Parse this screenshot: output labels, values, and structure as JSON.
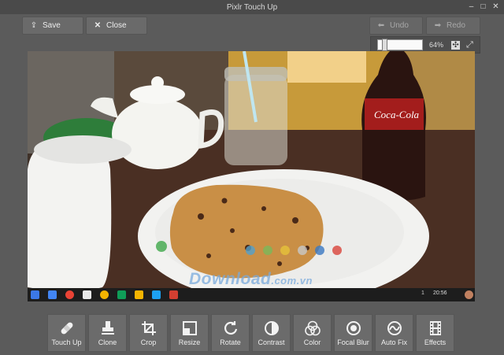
{
  "window": {
    "title": "Pixlr Touch Up"
  },
  "toolbar": {
    "save_label": "Save",
    "close_label": "Close",
    "undo_label": "Undo",
    "redo_label": "Redo"
  },
  "zoom": {
    "level": "64%",
    "slider_value": 0.1
  },
  "canvas": {
    "watermark": "Download",
    "watermark_suffix": ".com.vn",
    "shelf_clock": "20:56",
    "shelf_badge": "1"
  },
  "tools": [
    {
      "label": "Touch Up",
      "icon": "bandage-icon"
    },
    {
      "label": "Clone",
      "icon": "stamp-icon"
    },
    {
      "label": "Crop",
      "icon": "crop-icon"
    },
    {
      "label": "Resize",
      "icon": "resize-icon"
    },
    {
      "label": "Rotate",
      "icon": "rotate-icon"
    },
    {
      "label": "Contrast",
      "icon": "contrast-icon"
    },
    {
      "label": "Color",
      "icon": "color-icon"
    },
    {
      "label": "Focal Blur",
      "icon": "focal-blur-icon"
    },
    {
      "label": "Auto Fix",
      "icon": "auto-fix-icon"
    },
    {
      "label": "Effects",
      "icon": "effects-icon"
    }
  ]
}
